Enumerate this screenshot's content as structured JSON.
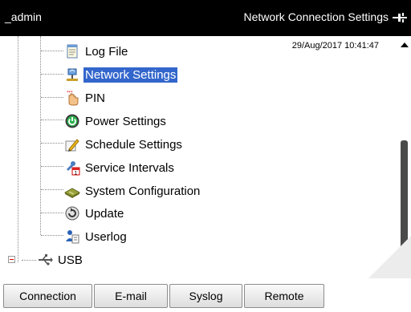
{
  "header": {
    "user": "_admin",
    "title": "Network Connection Settings"
  },
  "datetime": "29/Aug/2017 10:41:47",
  "tree": {
    "items": [
      {
        "label": "Log File",
        "icon": "log-file-icon"
      },
      {
        "label": "Network Settings",
        "icon": "network-settings-icon",
        "selected": true
      },
      {
        "label": "PIN",
        "icon": "pin-icon"
      },
      {
        "label": "Power Settings",
        "icon": "power-icon"
      },
      {
        "label": "Schedule Settings",
        "icon": "schedule-icon"
      },
      {
        "label": "Service Intervals",
        "icon": "service-intervals-icon"
      },
      {
        "label": "System Configuration",
        "icon": "system-configuration-icon"
      },
      {
        "label": "Update",
        "icon": "update-icon"
      },
      {
        "label": "Userlog",
        "icon": "userlog-icon"
      }
    ],
    "usb": {
      "label": "USB",
      "icon": "usb-icon"
    }
  },
  "tabs": [
    {
      "label": "Connection"
    },
    {
      "label": "E-mail"
    },
    {
      "label": "Syslog"
    },
    {
      "label": "Remote"
    }
  ]
}
